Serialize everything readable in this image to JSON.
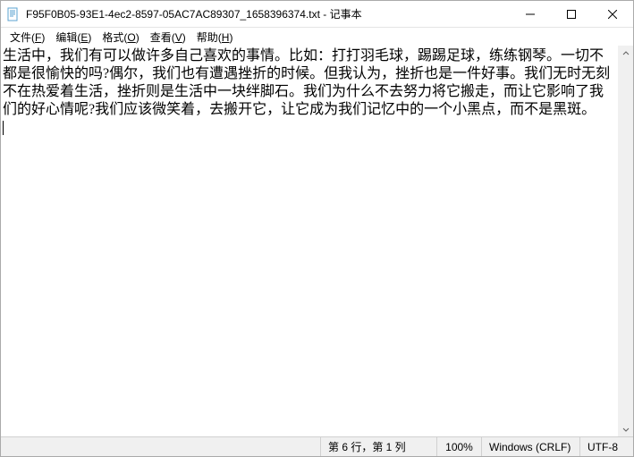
{
  "titlebar": {
    "title": "F95F0B05-93E1-4ec2-8597-05AC7AC89307_1658396374.txt - 记事本"
  },
  "menu": {
    "file": {
      "label": "文件",
      "accel": "F"
    },
    "edit": {
      "label": "编辑",
      "accel": "E"
    },
    "format": {
      "label": "格式",
      "accel": "O"
    },
    "view": {
      "label": "查看",
      "accel": "V"
    },
    "help": {
      "label": "帮助",
      "accel": "H"
    }
  },
  "editor": {
    "content": "生活中，我们有可以做许多自己喜欢的事情。比如：打打羽毛球，踢踢足球，练练钢琴。一切不都是很愉快的吗?偶尔，我们也有遭遇挫折的时候。但我认为，挫折也是一件好事。我们无时无刻不在热爱着生活，挫折则是生活中一块绊脚石。我们为什么不去努力将它搬走，而让它影响了我们的好心情呢?我们应该微笑着，去搬开它，让它成为我们记忆中的一个小黑点，而不是黑斑。\n"
  },
  "status": {
    "position": "第 6 行，第 1 列",
    "zoom": "100%",
    "eol": "Windows (CRLF)",
    "encoding": "UTF-8"
  }
}
